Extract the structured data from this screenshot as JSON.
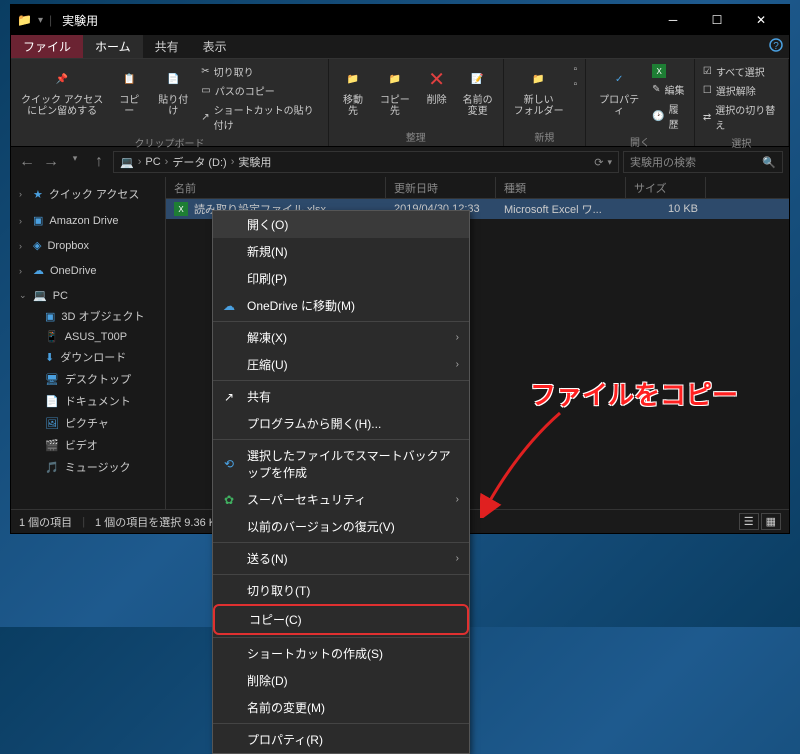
{
  "window": {
    "title": "実験用"
  },
  "tabs": {
    "file": "ファイル",
    "home": "ホーム",
    "share": "共有",
    "view": "表示"
  },
  "ribbon": {
    "clipboard": {
      "pin": "クイック アクセス\nにピン留めする",
      "copy": "コピー",
      "paste": "貼り付け",
      "cut": "切り取り",
      "copyPath": "パスのコピー",
      "pasteShortcut": "ショートカットの貼り付け",
      "label": "クリップボード"
    },
    "organize": {
      "moveTo": "移動先",
      "copyTo": "コピー先",
      "delete": "削除",
      "rename": "名前の\n変更",
      "label": "整理"
    },
    "new": {
      "newFolder": "新しい\nフォルダー",
      "label": "新規"
    },
    "open": {
      "properties": "プロパティ",
      "edit": "編集",
      "history": "履歴",
      "label": "開く"
    },
    "select": {
      "selectAll": "すべて選択",
      "selectNone": "選択解除",
      "invert": "選択の切り替え",
      "label": "選択"
    }
  },
  "breadcrumb": {
    "pc": "PC",
    "drive": "データ (D:)",
    "folder": "実験用"
  },
  "search": {
    "placeholder": "実験用の検索"
  },
  "columns": {
    "name": "名前",
    "date": "更新日時",
    "type": "種類",
    "size": "サイズ"
  },
  "nav": {
    "quickAccess": "クイック アクセス",
    "amazonDrive": "Amazon Drive",
    "dropbox": "Dropbox",
    "oneDrive": "OneDrive",
    "pc": "PC",
    "objects3d": "3D オブジェクト",
    "asus": "ASUS_T00P",
    "downloads": "ダウンロード",
    "desktop": "デスクトップ",
    "documents": "ドキュメント",
    "pictures": "ピクチャ",
    "videos": "ビデオ",
    "music": "ミュージック"
  },
  "file": {
    "name": "読み取り設定ファイル.xlsx",
    "date": "2019/04/30 12:33",
    "type": "Microsoft Excel ワ...",
    "size": "10 KB"
  },
  "status": {
    "items": "1 個の項目",
    "selected": "1 個の項目を選択 9.36 KB"
  },
  "context": {
    "open": "開く(O)",
    "new": "新規(N)",
    "print": "印刷(P)",
    "oneDrive": "OneDrive に移動(M)",
    "extract": "解凍(X)",
    "compress": "圧縮(U)",
    "share": "共有",
    "openWith": "プログラムから開く(H)...",
    "smartBackup": "選択したファイルでスマートバックアップを作成",
    "superSecurity": "スーパーセキュリティ",
    "restore": "以前のバージョンの復元(V)",
    "sendTo": "送る(N)",
    "cut": "切り取り(T)",
    "copy": "コピー(C)",
    "createShortcut": "ショートカットの作成(S)",
    "delete": "削除(D)",
    "rename": "名前の変更(M)",
    "properties": "プロパティ(R)"
  },
  "annotation": {
    "text": "ファイルをコピー"
  }
}
